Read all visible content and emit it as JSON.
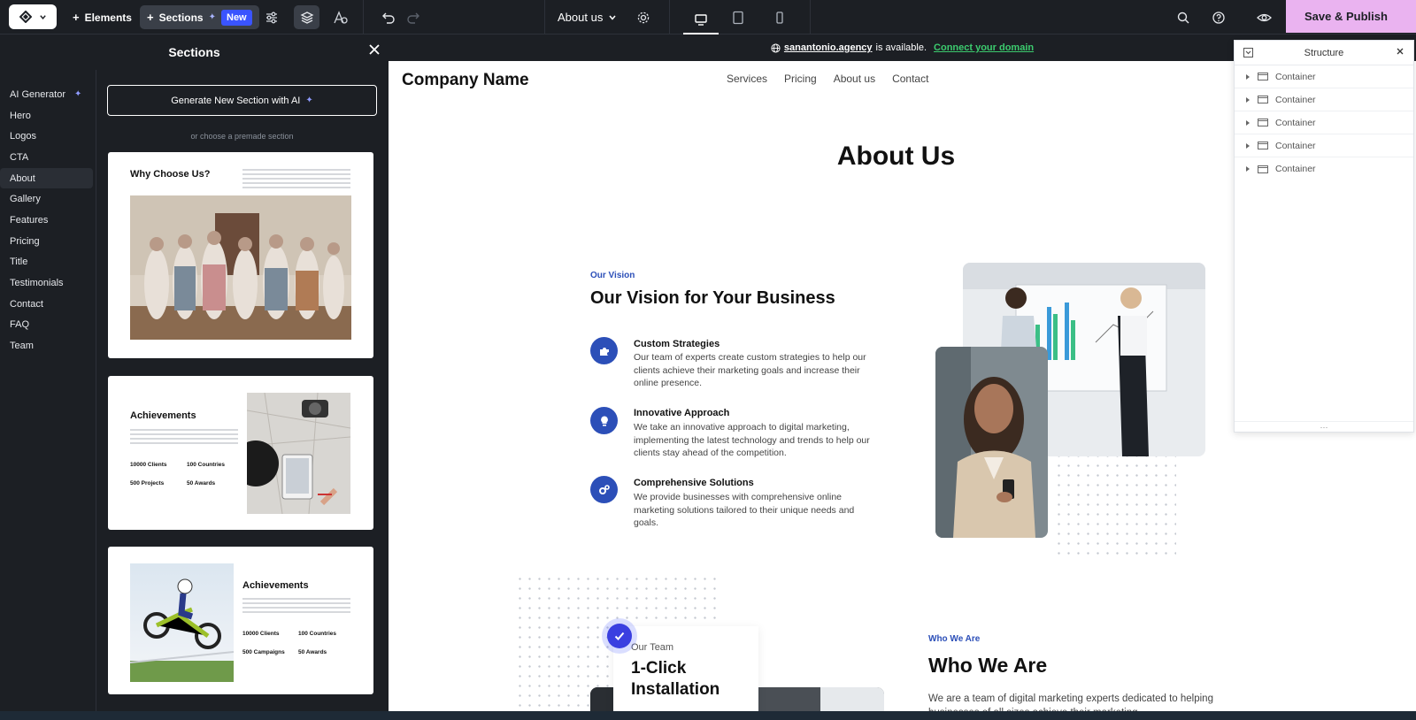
{
  "toolbar": {
    "elements_label": "Elements",
    "sections_label": "Sections",
    "new_badge": "New",
    "page_select": "About us",
    "publish_label": "Save & Publish"
  },
  "panel": {
    "title": "Sections",
    "categories": [
      "AI Generator",
      "Hero",
      "Logos",
      "CTA",
      "About",
      "Gallery",
      "Features",
      "Pricing",
      "Title",
      "Testimonials",
      "Contact",
      "FAQ",
      "Team"
    ],
    "active_category": "About",
    "generate_label": "Generate New Section with AI",
    "choose_label": "or choose a premade section",
    "cards": [
      {
        "title": "Why Choose Us?"
      },
      {
        "title": "Achievements",
        "stats": [
          {
            "value": "10000 Clients"
          },
          {
            "value": "100 Countries"
          },
          {
            "value": "500 Projects"
          },
          {
            "value": "50 Awards"
          }
        ]
      },
      {
        "title": "Achievements",
        "stats": [
          {
            "value": "10000 Clients"
          },
          {
            "value": "100 Countries"
          },
          {
            "value": "500 Campaigns"
          },
          {
            "value": "50 Awards"
          }
        ]
      }
    ]
  },
  "notice": {
    "domain": "sanantonio.agency",
    "text": "is available.",
    "link": "Connect your domain"
  },
  "site": {
    "brand": "Company Name",
    "nav": [
      "Services",
      "Pricing",
      "About us",
      "Contact"
    ],
    "page_heading": "About Us",
    "vision": {
      "kicker": "Our Vision",
      "heading": "Our Vision for Your Business",
      "features": [
        {
          "title": "Custom Strategies",
          "text": "Our team of experts create custom strategies to help our clients achieve their marketing goals and increase their online presence."
        },
        {
          "title": "Innovative Approach",
          "text": "We take an innovative approach to digital marketing, implementing the latest technology and trends to help our clients stay ahead of the competition."
        },
        {
          "title": "Comprehensive Solutions",
          "text": "We provide businesses with comprehensive online marketing solutions tailored to their unique needs and goals."
        }
      ]
    },
    "team_card": {
      "label": "Our Team",
      "title": "1-Click Installation"
    },
    "who": {
      "kicker": "Who We Are",
      "heading": "Who We Are",
      "text": "We are a team of digital marketing experts dedicated to helping businesses of all sizes achieve their marketing"
    }
  },
  "structure": {
    "title": "Structure",
    "items": [
      "Container",
      "Container",
      "Container",
      "Container",
      "Container"
    ]
  },
  "colors": {
    "accent": "#2c4fb8",
    "publish": "#eab3f0",
    "dark": "#1c1f24",
    "link_green": "#3ccb6e"
  }
}
